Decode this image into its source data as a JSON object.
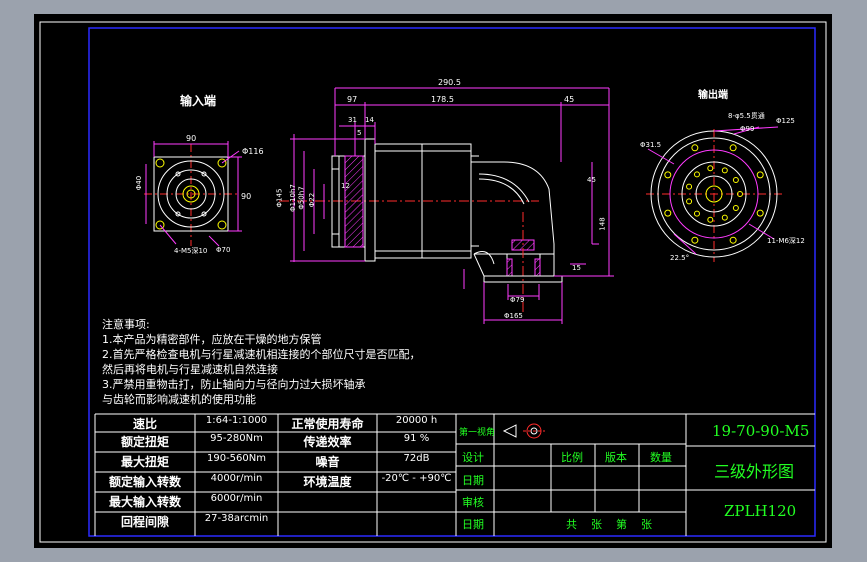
{
  "colors": {
    "frame": "#ffffff",
    "border": "#2222ff",
    "dim": "#ff3bff",
    "body": "#ffffff",
    "center": "#ff2b2b",
    "hole": "#ffff00",
    "cyan": "#00ffff",
    "title_text": "#22ff22",
    "background": "#000000"
  },
  "views": {
    "input_title": "输入端",
    "output_title": "输出端"
  },
  "dims": {
    "overall_length": "290.5",
    "d97": "97",
    "d178_5": "178.5",
    "d45": "45",
    "d31": "31",
    "d14": "14",
    "d5": "5",
    "d_phi145": "Φ145",
    "d_phi110": "Φ110h7",
    "d_phi50": "Φ50h7",
    "d_phi22": "Φ22",
    "d12": "12",
    "d_phi165": "Φ165",
    "d45_right": "45",
    "d148": "148",
    "d15": "15",
    "phi_115": "Φ115",
    "phi_160": "Φ160",
    "sq90": "90",
    "sq90b": "90",
    "phi116": "Φ116",
    "holes_in": "4-M5深10",
    "phi40": "Φ40",
    "d_phi70": "Φ70",
    "holes_out": "8-φ5.5贯通",
    "phi99": "Φ99",
    "phi125": "Φ125",
    "phi31_5": "Φ31.5",
    "holes_out2": "11-M6深12",
    "ang22_5": "22.5°",
    "phi79": "Φ79"
  },
  "notes": [
    "注意事项:",
    "1.本产品为精密部件，应放在干燥的地方保管",
    "2.首先严格检查电机与行星减速机相连接的个部位尺寸是否匹配，",
    "然后再将电机与行星减速机自然连接",
    "3.严禁用重物击打，防止轴向力与径向力过大损坏轴承",
    "与齿轮而影响减速机的使用功能"
  ],
  "specs": [
    {
      "label": "速比",
      "value": "1:64-1:1000",
      "label2": "正常使用寿命",
      "value2": "20000 h"
    },
    {
      "label": "额定扭矩",
      "value": "95-280Nm",
      "label2": "传递效率",
      "value2": "91 %"
    },
    {
      "label": "最大扭矩",
      "value": "190-560Nm",
      "label2": "噪音",
      "value2": "72dB"
    },
    {
      "label": "额定输入转数",
      "value": "4000r/min",
      "label2": "环境温度",
      "value2": "-20℃ - +90℃"
    },
    {
      "label": "最大输入转数",
      "value": "6000r/min",
      "label2": "",
      "value2": ""
    },
    {
      "label": "回程间隙",
      "value": "27-38arcmin",
      "label2": "",
      "value2": ""
    }
  ],
  "title_block": {
    "projection": "第一视角",
    "design": "设计",
    "scale": "比例",
    "version": "版本",
    "quantity": "数量",
    "date1": "日期",
    "review": "审核",
    "date2": "日期",
    "sheets": "共    张    第    张",
    "drawing_no": "19-70-90-M5",
    "drawing_name": "三级外形图",
    "model": "ZPLH120"
  }
}
